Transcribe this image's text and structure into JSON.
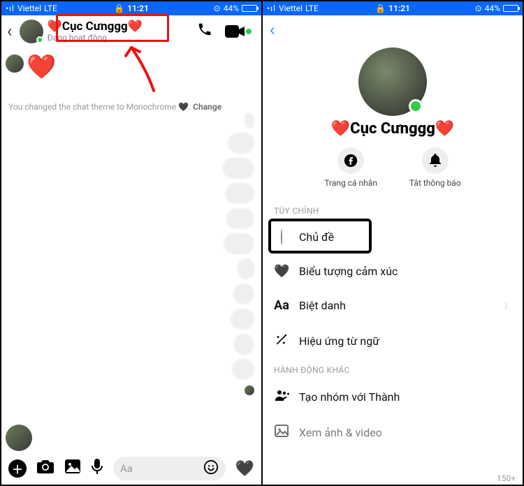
{
  "status": {
    "carrier": "Viettel",
    "net": "LTE",
    "time": "11:21",
    "battery": "44%"
  },
  "left": {
    "name": "❤️Cục Cưnggg❤️",
    "sub": "Đang hoạt động",
    "system": "You changed the chat theme to Monochrome 🖤.",
    "change": "Change",
    "composer_placeholder": "Aa"
  },
  "right": {
    "name": "❤️Cục Cưnggg❤️",
    "actions": {
      "profile": "Trang cá nhân",
      "mute": "Tắt thông báo"
    },
    "sections": {
      "custom": "TÙY CHỈNH",
      "more": "HÀNH ĐỘNG KHÁC"
    },
    "rows": {
      "theme": "Chủ đề",
      "emoji": "Biểu tượng cảm xúc",
      "nick": "Biệt danh",
      "word": "Hiệu ứng từ ngữ",
      "group": "Tạo nhóm với Thành",
      "media": "Xem ảnh & video"
    },
    "counter": "150+"
  }
}
